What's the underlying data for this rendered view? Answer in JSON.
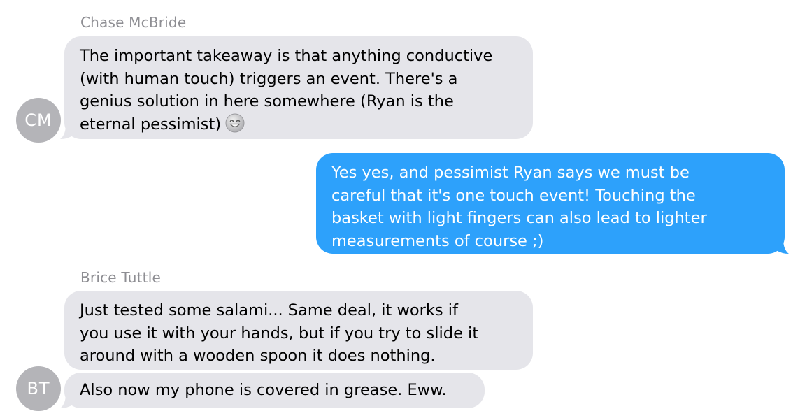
{
  "colors": {
    "incoming_bubble": "#e5e5ea",
    "outgoing_bubble": "#2da1fb",
    "avatar_bg": "#b4b4b8",
    "sender_name": "#8e8e93"
  },
  "messages": {
    "group1": {
      "sender": "Chase McBride",
      "avatar_initials": "CM",
      "m1": {
        "lines": [
          "The important takeaway is that anything conductive",
          "(with human touch) triggers an event. There's a",
          "genius solution in here somewhere (Ryan is the",
          "eternal pessimist)"
        ],
        "emoji": "grinning-face-emoji"
      }
    },
    "outgoing": {
      "m1": {
        "lines": [
          "Yes yes, and pessimist Ryan says we must be",
          "careful that it's one touch event! Touching the",
          "basket with light fingers can also lead to lighter",
          "measurements of course ;)"
        ]
      }
    },
    "group2": {
      "sender": "Brice Tuttle",
      "avatar_initials": "BT",
      "m1": {
        "lines": [
          "Just tested some salami... Same deal, it works if",
          "you use it with your hands, but if you try to slide it",
          "around with a wooden spoon it does nothing."
        ]
      },
      "m2": {
        "lines": [
          "Also now my phone is covered in grease. Eww."
        ]
      }
    }
  }
}
